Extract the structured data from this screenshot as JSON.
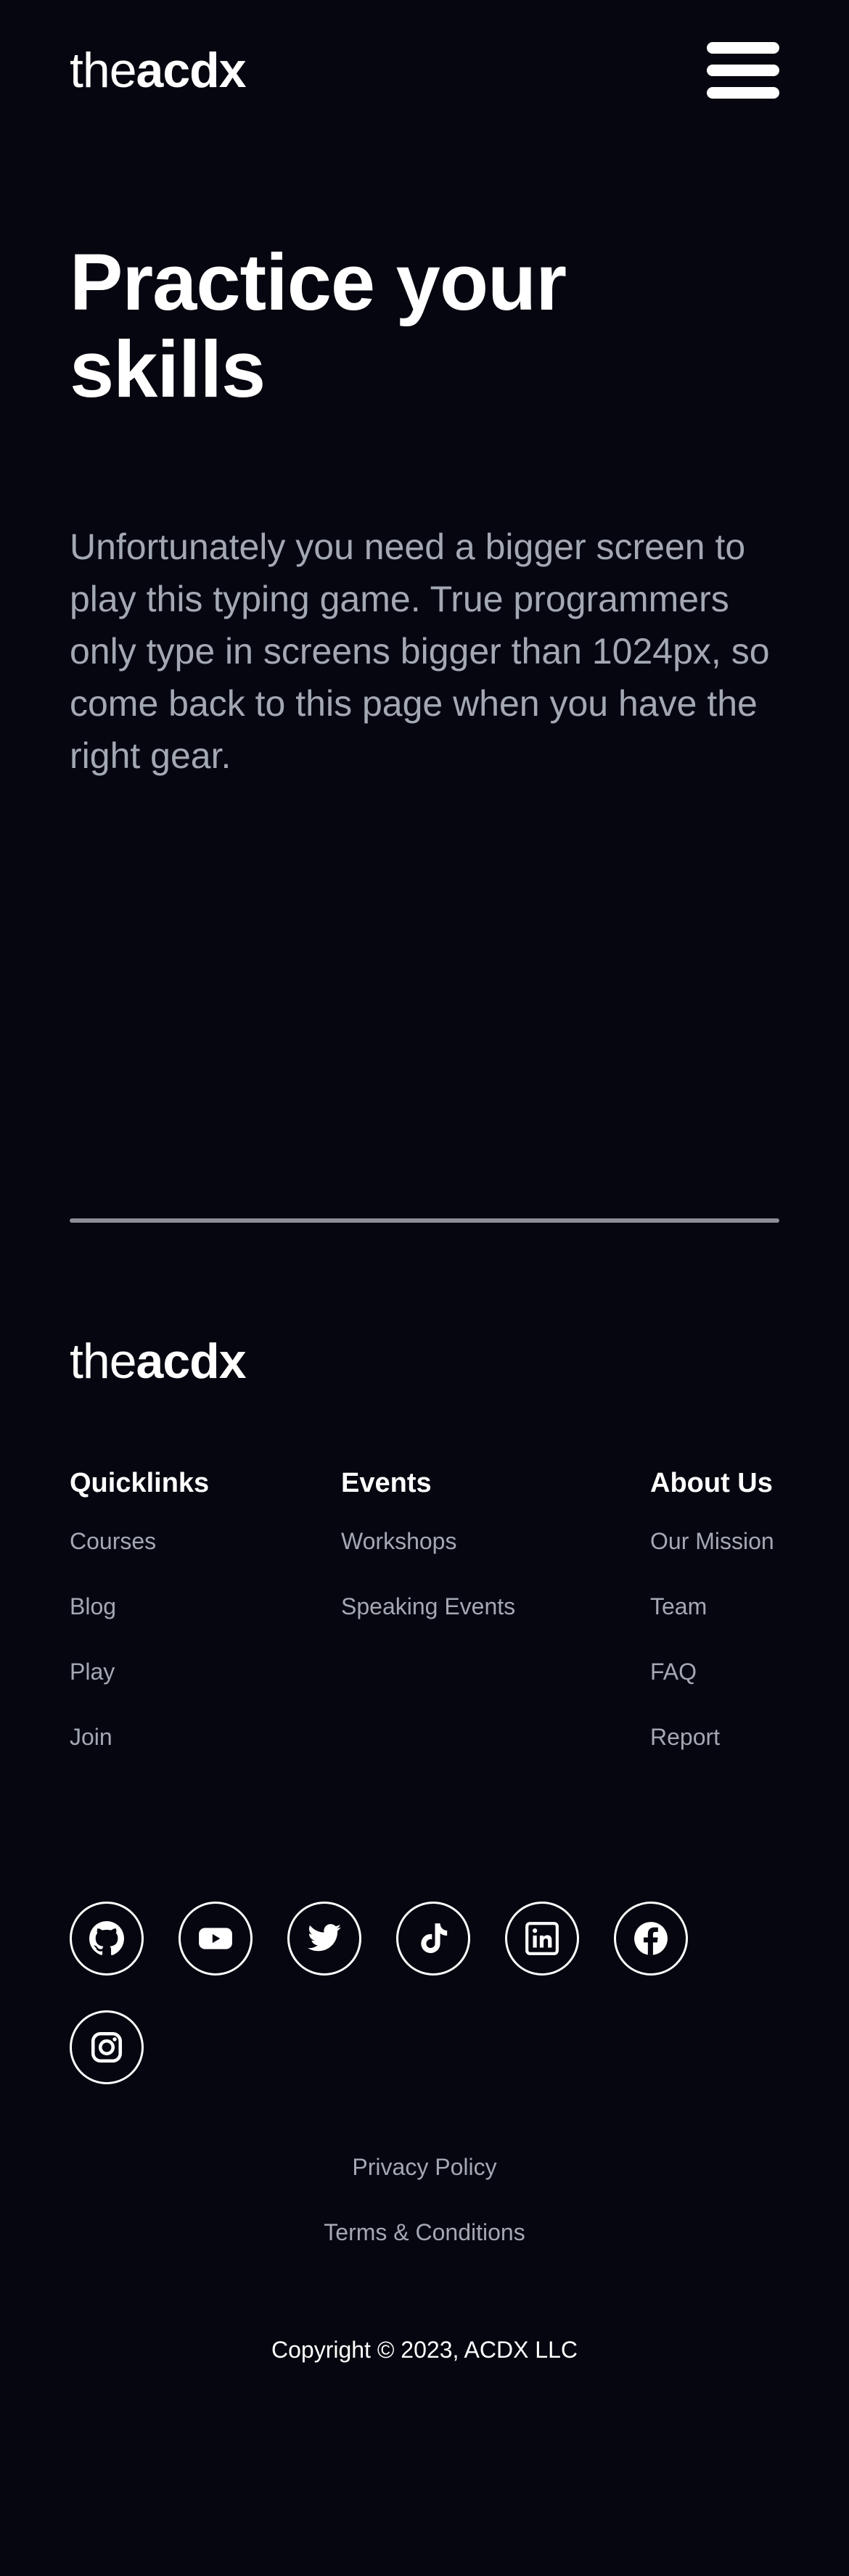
{
  "header": {
    "logo_light": "the",
    "logo_bold": "acdx",
    "menu_icon": "hamburger-menu-icon"
  },
  "hero": {
    "title": "Practice your skills",
    "message": "Unfortunately you need a bigger screen to play this typing game. True programmers only type in screens bigger than 1024px, so come back to this page when you have the right gear."
  },
  "footer": {
    "logo_light": "the",
    "logo_bold": "acdx",
    "columns": [
      {
        "heading": "Quicklinks",
        "links": [
          "Courses",
          "Blog",
          "Play",
          "Join"
        ]
      },
      {
        "heading": "Events",
        "links": [
          "Workshops",
          "Speaking Events"
        ]
      },
      {
        "heading": "About Us",
        "links": [
          "Our Mission",
          "Team",
          "FAQ",
          "Report"
        ]
      }
    ],
    "socials": [
      "github-icon",
      "youtube-icon",
      "twitter-icon",
      "tiktok-icon",
      "linkedin-icon",
      "facebook-icon",
      "instagram-icon"
    ],
    "privacy": "Privacy Policy",
    "terms": "Terms & Conditions",
    "copyright": "Copyright © 2023, ACDX LLC"
  },
  "colors": {
    "background": "#05060f",
    "text": "#ffffff",
    "muted_text": "#a4a8b3",
    "divider": "#8b8e96"
  }
}
